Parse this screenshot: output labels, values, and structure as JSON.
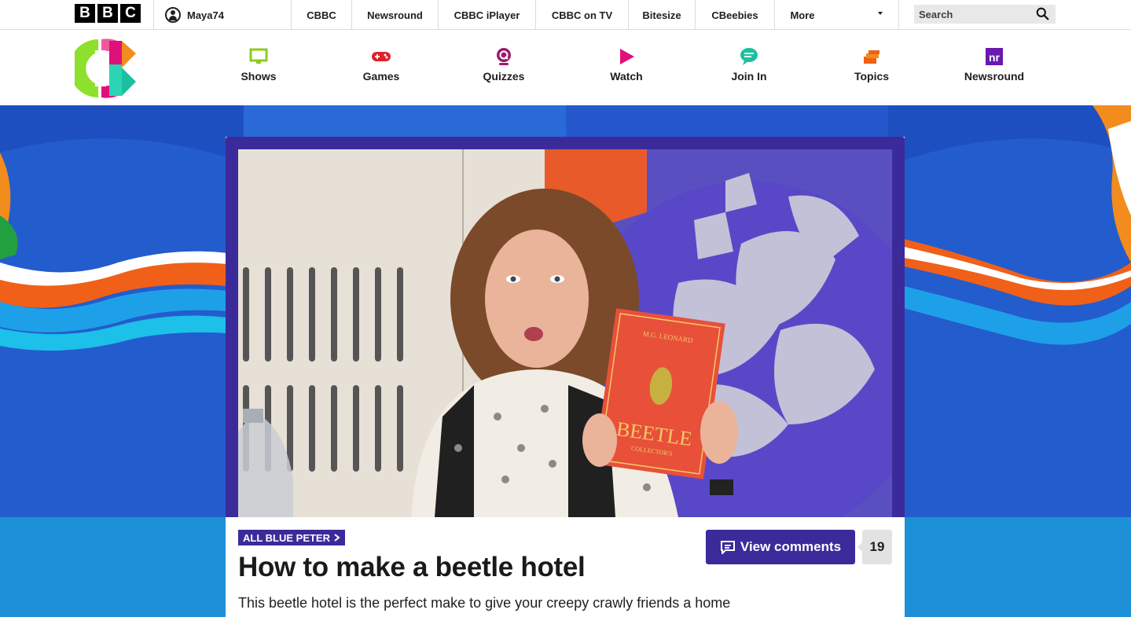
{
  "global_nav": {
    "logo_letters": [
      "B",
      "B",
      "C"
    ],
    "account_name": "Maya74",
    "links": [
      "CBBC",
      "Newsround",
      "CBBC iPlayer",
      "CBBC on TV",
      "Bitesize",
      "CBeebies",
      "More"
    ],
    "search_placeholder": "Search"
  },
  "cbbc_nav": {
    "items": [
      {
        "label": "Shows",
        "icon": "tv-icon",
        "color": "#8ccc1c"
      },
      {
        "label": "Games",
        "icon": "gamepad-icon",
        "color": "#e0202c"
      },
      {
        "label": "Quizzes",
        "icon": "quiz-icon",
        "color": "#9b1c6e"
      },
      {
        "label": "Watch",
        "icon": "play-icon",
        "color": "#e0107a"
      },
      {
        "label": "Join In",
        "icon": "chat-icon",
        "color": "#1cc0a0"
      },
      {
        "label": "Topics",
        "icon": "topics-icon",
        "color": "#f06018"
      },
      {
        "label": "Newsround",
        "icon": "newsround-icon",
        "color": "#6a18b0",
        "icon_text": "nr"
      }
    ]
  },
  "article": {
    "tag": "ALL BLUE PETER",
    "title": "How to make a beetle hotel",
    "description": "This beetle hotel is the perfect make to give your creepy crawly friends a home they will LOVE buzzing out here. M.G Leonard is the author of 'Beetle",
    "comments_label": "View comments",
    "comments_count": "19",
    "book_author": "M.G. LEONARD",
    "book_title": "BEETLE",
    "book_subtitle": "COLLECTOR'S"
  },
  "colors": {
    "brand_purple": "#3b2b9a",
    "hero_blue": "#1e54c8",
    "hero_lower_blue": "#1e90d8"
  }
}
